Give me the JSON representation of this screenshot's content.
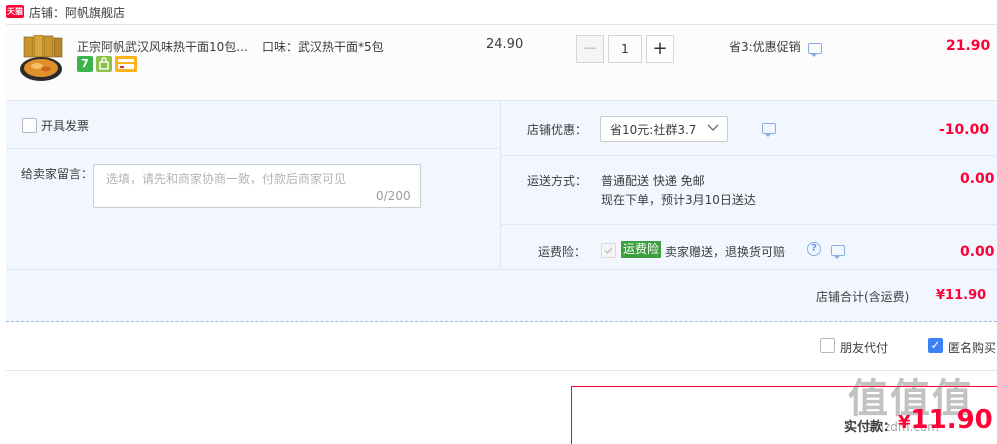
{
  "shop": {
    "badge": "天猫",
    "label": "店铺：阿帆旗舰店"
  },
  "product": {
    "title": "正宗阿帆武汉风味热干面10包...",
    "sku": "口味：武汉热干面*5包",
    "unit_price": "24.90",
    "quantity": "1",
    "qty_minus": "−",
    "qty_plus": "+",
    "promo": "省3:优惠促销",
    "subtotal": "21.90",
    "service_icons": [
      "seven-day-return-icon",
      "shopping-bag-icon",
      "card-icon"
    ],
    "service_icon_text": {
      "seven": "7"
    }
  },
  "invoice": {
    "label": "开具发票"
  },
  "message": {
    "label": "给卖家留言：",
    "placeholder": "选填，请先和商家协商一致，付款后商家可见",
    "count": "0/200"
  },
  "coupon": {
    "label": "店铺优惠：",
    "selected": "省10元:社群3.7",
    "amount": "-10.00"
  },
  "shipping": {
    "label": "运送方式：",
    "line1": "普通配送 快递 免邮",
    "line2": "现在下单，预计3月10日送达",
    "amount": "0.00"
  },
  "insurance": {
    "label": "运费险：",
    "tag": "运费险",
    "text": "卖家赠送，退换货可赔",
    "help": "?",
    "amount": "0.00"
  },
  "shop_total": {
    "label": "店铺合计(含运费)",
    "amount": "¥11.90"
  },
  "options": {
    "friend_pay": "朋友代付",
    "anonymous": "匿名购买",
    "anonymous_checked": "✓"
  },
  "pay": {
    "label": "实付款：",
    "currency": "¥",
    "amount": "11.90"
  },
  "watermark": {
    "text": "值值值",
    "sub": "smzdm.com"
  },
  "colors": {
    "price_red": "#ff0036",
    "panel_bg": "#f2f7ff",
    "checkbox_blue": "#3b82f6",
    "insurance_green": "#3d9e3d"
  }
}
